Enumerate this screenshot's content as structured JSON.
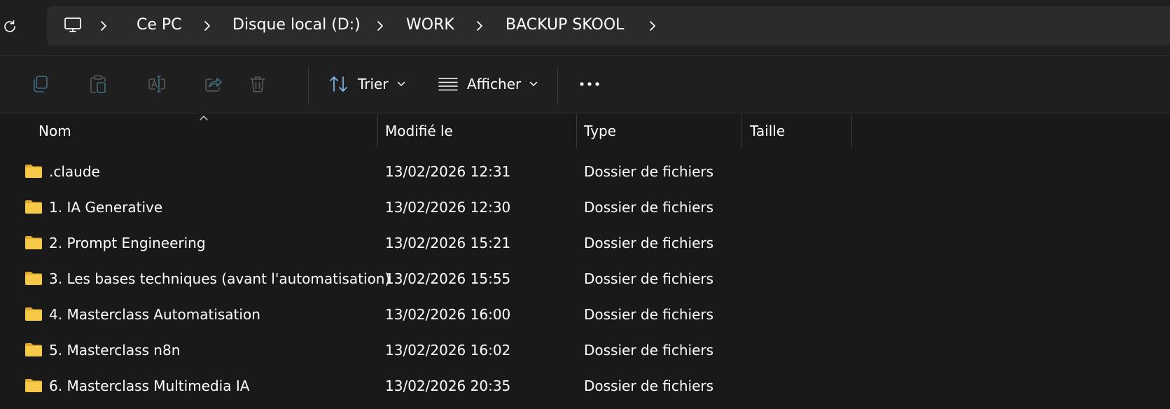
{
  "address_bar": {
    "breadcrumbs": [
      "Ce PC",
      "Disque local (D:)",
      "WORK",
      "BACKUP SKOOL"
    ]
  },
  "toolbar": {
    "sort_label": "Trier",
    "view_label": "Afficher"
  },
  "columns": {
    "name": "Nom",
    "modified": "Modifié le",
    "type": "Type",
    "size": "Taille"
  },
  "files": [
    {
      "name": ".claude",
      "modified": "13/02/2026 12:31",
      "type": "Dossier de fichiers",
      "size": ""
    },
    {
      "name": "1. IA Generative",
      "modified": "13/02/2026 12:30",
      "type": "Dossier de fichiers",
      "size": ""
    },
    {
      "name": "2. Prompt Engineering",
      "modified": "13/02/2026 15:21",
      "type": "Dossier de fichiers",
      "size": ""
    },
    {
      "name": "3. Les bases techniques (avant l'automatisation)",
      "modified": "13/02/2026 15:55",
      "type": "Dossier de fichiers",
      "size": ""
    },
    {
      "name": "4. Masterclass Automatisation",
      "modified": "13/02/2026 16:00",
      "type": "Dossier de fichiers",
      "size": ""
    },
    {
      "name": "5. Masterclass n8n",
      "modified": "13/02/2026 16:02",
      "type": "Dossier de fichiers",
      "size": ""
    },
    {
      "name": "6. Masterclass Multimedia IA",
      "modified": "13/02/2026 20:35",
      "type": "Dossier de fichiers",
      "size": ""
    }
  ],
  "colors": {
    "background": "#191919",
    "toolbar": "#1f1f1f",
    "address_field": "#2b2b2b",
    "folder": "#f3c03d",
    "sort_accent": "#7fb6e8"
  },
  "icons": [
    "refresh-icon",
    "this-pc-icon",
    "chevron-right-icon",
    "copy-icon",
    "paste-icon",
    "rename-icon",
    "share-icon",
    "delete-icon",
    "sort-icon",
    "view-icon",
    "chevron-down-icon",
    "more-icon",
    "folder-icon"
  ]
}
